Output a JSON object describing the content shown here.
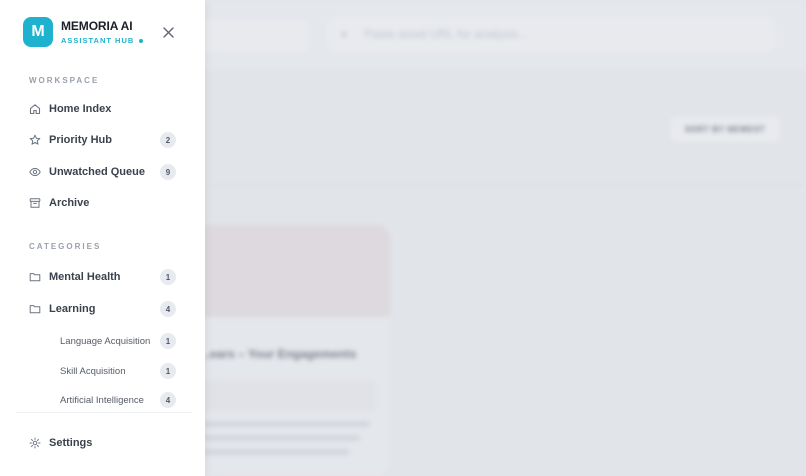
{
  "background": {
    "search_placeholder": "Paste asset URL for analysis...",
    "sort_label": "SORT BY NEWEST",
    "card_title": "...ears – Your Engagements"
  },
  "sidebar": {
    "logo_letter": "M",
    "app_name": "MEMORIA AI",
    "app_subtitle": "ASSISTANT HUB",
    "workspace_label": "WORKSPACE",
    "workspace_items": [
      {
        "label": "Home Index",
        "icon": "home-icon",
        "count": null
      },
      {
        "label": "Priority Hub",
        "icon": "star-icon",
        "count": "2"
      },
      {
        "label": "Unwatched Queue",
        "icon": "eye-icon",
        "count": "9"
      },
      {
        "label": "Archive",
        "icon": "archive-icon",
        "count": null
      }
    ],
    "categories_label": "CATEGORIES",
    "categories": [
      {
        "label": "Mental Health",
        "icon": "folder-icon",
        "count": "1"
      },
      {
        "label": "Learning",
        "icon": "folder-icon",
        "count": "4"
      }
    ],
    "subcategories": [
      {
        "label": "Language Acquisition",
        "count": "1"
      },
      {
        "label": "Skill Acquisition",
        "count": "1"
      },
      {
        "label": "Artificial Intelligence",
        "count": "4"
      }
    ],
    "settings_label": "Settings",
    "accent_color": "#1fb2cf"
  }
}
